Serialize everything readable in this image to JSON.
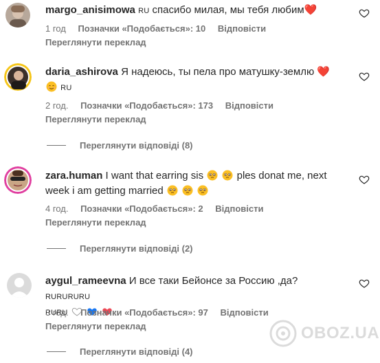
{
  "comments": [
    {
      "username": "margo_anisimowa",
      "lang": "RU",
      "text": "спасибо милая, мы тебя любим",
      "time": "1 год",
      "likes": "Позначки «Подобається»: 10",
      "reply": "Відповісти",
      "translate": "Переглянути переклад"
    },
    {
      "username": "daria_ashirova",
      "text": "Я надеюсь, ты пела про матушку-землю",
      "lang": "RU",
      "time": "2 год.",
      "likes": "Позначки «Подобається»: 173",
      "reply": "Відповісти",
      "translate": "Переглянути переклад",
      "view_replies": "Переглянути відповіді (8)"
    },
    {
      "username": "zara.human",
      "text": "I want that earring sis",
      "text2": "ples donat me, next",
      "text3": "week i am getting married",
      "time": "4 год.",
      "likes": "Позначки «Подобається»: 2",
      "reply": "Відповісти",
      "translate": "Переглянути переклад",
      "view_replies": "Переглянути відповіді (2)"
    },
    {
      "username": "aygul_rameevna",
      "text": "И все таки Бейонсе за Россию ,да?",
      "lang1": "RURURURU",
      "lang2": "RURU",
      "time": "3 год.",
      "likes": "Позначки «Подобається»: 97",
      "reply": "Відповісти",
      "translate": "Переглянути переклад",
      "view_replies": "Переглянути відповіді (4)"
    }
  ],
  "watermark": "OBOZ.UA",
  "colors": {
    "muted": "#737373",
    "text": "#262626",
    "heart": "#ed4956",
    "blue_heart": "#1877f2"
  },
  "icons": [
    "heart-outline-icon",
    "crying-face-emoji",
    "smiling-face-emoji",
    "red-heart-emoji",
    "white-heart-emoji",
    "blue-heart-emoji"
  ]
}
